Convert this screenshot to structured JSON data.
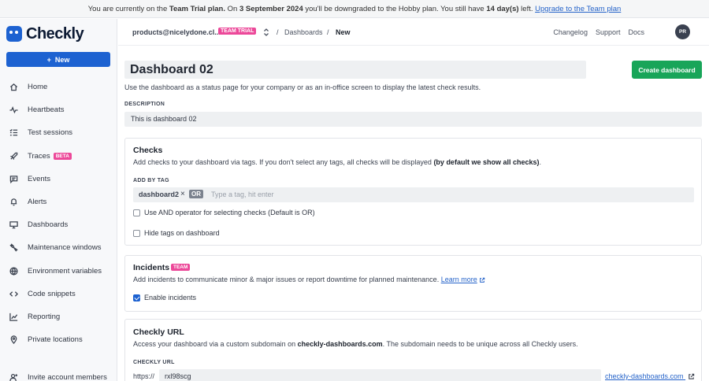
{
  "banner": {
    "part1": "You are currently on the ",
    "plan": "Team Trial plan.",
    "part2": " On ",
    "date": "3 September 2024",
    "part3": " you'll be downgraded to the Hobby plan. You still have ",
    "days": "14 day(s)",
    "part4": " left. ",
    "upgrade_link": "Upgrade to the Team plan"
  },
  "brand": {
    "name": "Checkly"
  },
  "sidebar": {
    "new_button": "New",
    "items": [
      {
        "label": "Home",
        "icon": "home-icon"
      },
      {
        "label": "Heartbeats",
        "icon": "pulse-icon"
      },
      {
        "label": "Test sessions",
        "icon": "list-check-icon"
      },
      {
        "label": "Traces",
        "icon": "rocket-icon",
        "badge": "BETA"
      },
      {
        "label": "Events",
        "icon": "chat-icon"
      },
      {
        "label": "Alerts",
        "icon": "bell-icon"
      },
      {
        "label": "Dashboards",
        "icon": "monitor-icon"
      },
      {
        "label": "Maintenance windows",
        "icon": "tool-icon"
      },
      {
        "label": "Environment variables",
        "icon": "globe-icon"
      },
      {
        "label": "Code snippets",
        "icon": "code-icon"
      },
      {
        "label": "Reporting",
        "icon": "chart-icon"
      },
      {
        "label": "Private locations",
        "icon": "location-pin-icon"
      }
    ],
    "invite": "Invite account members"
  },
  "topbar": {
    "account": "products@nicelydone.cl...",
    "trial_badge": "TEAM TRIAL",
    "crumb_dashboards": "Dashboards",
    "crumb_current": "New",
    "links": [
      "Changelog",
      "Support",
      "Docs"
    ],
    "avatar_initials": "PR"
  },
  "form": {
    "title_value": "Dashboard 02",
    "create_button": "Create dashboard",
    "subtitle": "Use the dashboard as a status page for your company or as an in-office screen to display the latest check results.",
    "description_label": "DESCRIPTION",
    "description_value": "This is dashboard 02"
  },
  "checks": {
    "title": "Checks",
    "text1": "Add checks to your dashboard via tags. If you don't select any tags, all checks will be displayed ",
    "text_bold": "(by default we show all checks)",
    "text2": ".",
    "add_by_tag_label": "ADD BY TAG",
    "tag": "dashboard2",
    "tag_remove": "×",
    "or_label": "OR",
    "tag_placeholder": "Type a tag, hit enter",
    "and_operator_label": "Use AND operator for selecting checks (Default is OR)",
    "hide_tags_label": "Hide tags on dashboard"
  },
  "incidents": {
    "title": "Incidents",
    "badge": "TEAM",
    "text": "Add incidents to communicate minor & major issues or report downtime for planned maintenance. ",
    "learn_more": "Learn more",
    "enable_label": "Enable incidents"
  },
  "url": {
    "title": "Checkly URL",
    "text1": "Access your dashboard via a custom subdomain on ",
    "domain_bold": "checkly-dashboards.com",
    "text2": ". The subdomain needs to be unique across all Checkly users.",
    "label": "CHECKLY URL",
    "prefix": "https://",
    "value": "rxl98scg",
    "domain_link": "checkly-dashboards.com"
  }
}
